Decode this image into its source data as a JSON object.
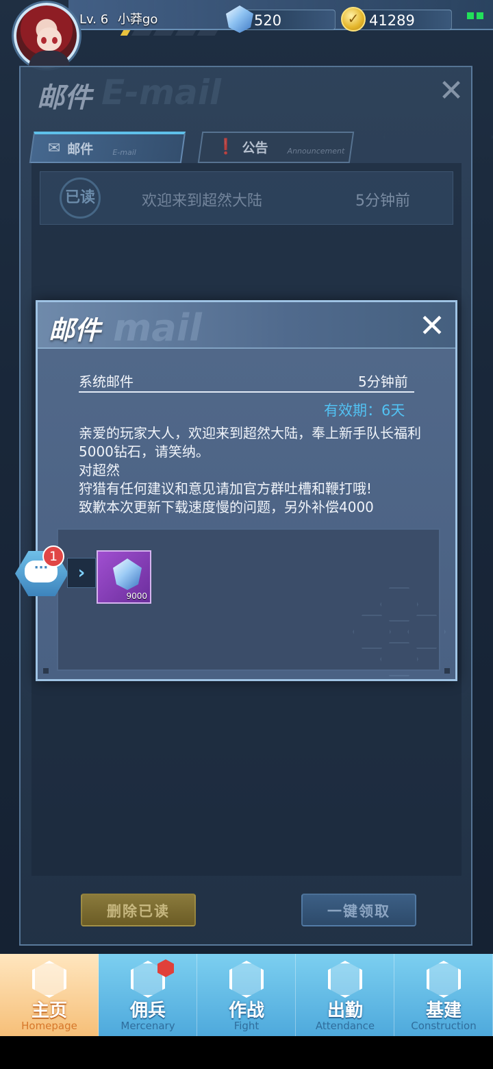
{
  "topbar": {
    "level": "Lv. 6",
    "player_name": "小莽go",
    "gems": "520",
    "gold": "41289",
    "colors": {
      "signal": "#22e05a",
      "level_tick": "#e9c23d"
    }
  },
  "mail_panel": {
    "title": "邮件",
    "watermark": "E-mail",
    "tabs": [
      {
        "label": "邮件",
        "sub": "E-mail",
        "icon": "envelope-icon",
        "active": true
      },
      {
        "label": "公告",
        "sub": "Announcement",
        "icon": "exclamation-icon",
        "active": false
      }
    ],
    "rows": [
      {
        "status": "已读",
        "subject": "欢迎来到超然大陆",
        "time": "5分钟前"
      }
    ],
    "buttons": {
      "delete_read": "删除已读",
      "claim_all": "一键领取"
    }
  },
  "popup": {
    "title": "邮件",
    "watermark": "mail",
    "sender": "系统邮件",
    "time": "5分钟前",
    "validity": "有效期：6天",
    "body": "亲爱的玩家大人，欢迎来到超然大陆，奉上新手队长福利5000钻石，请笑纳。\n对超然\n狩猎有任何建议和意见请加官方群吐槽和鞭打哦!\n致歉本次更新下载速度慢的问题，另外补偿4000",
    "attachments": [
      {
        "item": "diamond",
        "icon": "diamond-icon",
        "quantity": "9000"
      }
    ],
    "colors": {
      "validity": "#52c2f3",
      "item_bg": "#a04fd0"
    }
  },
  "chat_float": {
    "badge_count": "1"
  },
  "bottom_nav": [
    {
      "label": "主页",
      "sub": "Homepage",
      "icon": "home-icon",
      "active": true,
      "badge": false
    },
    {
      "label": "佣兵",
      "sub": "Mercenary",
      "icon": "mercenary-icon",
      "active": false,
      "badge": true
    },
    {
      "label": "作战",
      "sub": "Fight",
      "icon": "fight-icon",
      "active": false,
      "badge": false
    },
    {
      "label": "出勤",
      "sub": "Attendance",
      "icon": "attendance-icon",
      "active": false,
      "badge": false
    },
    {
      "label": "基建",
      "sub": "Construction",
      "icon": "construction-icon",
      "active": false,
      "badge": false
    }
  ]
}
